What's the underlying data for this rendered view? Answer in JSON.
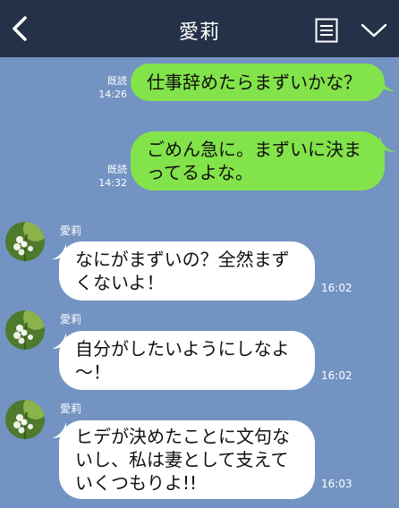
{
  "header": {
    "title": "愛莉",
    "back_icon": "chevron-left-icon",
    "menu_icon": "notes-icon",
    "expand_icon": "chevron-down-icon"
  },
  "messages": [
    {
      "direction": "sent",
      "read": "既読",
      "time": "14:26",
      "lines": [
        "仕事辞めたらまずいかな？"
      ]
    },
    {
      "direction": "sent",
      "read": "既読",
      "time": "14:32",
      "lines": [
        "ごめん急に。まずいに決ま",
        "ってるよな。"
      ]
    },
    {
      "direction": "received",
      "sender": "愛莉",
      "time": "16:02",
      "lines": [
        "なにがまずいの？全然まず",
        "くないよ！"
      ]
    },
    {
      "direction": "received",
      "sender": "愛莉",
      "time": "16:02",
      "lines": [
        "自分がしたいようにしなよ",
        "〜！"
      ]
    },
    {
      "direction": "received",
      "sender": "愛莉",
      "time": "16:03",
      "lines": [
        "ヒデが決めたことに文句な",
        "いし、私は妻として支えて",
        "いくつもりよ!!"
      ]
    }
  ],
  "colors": {
    "background": "#7393c3",
    "header": "#243148",
    "sent": "#83e34a",
    "received": "#ffffff"
  }
}
